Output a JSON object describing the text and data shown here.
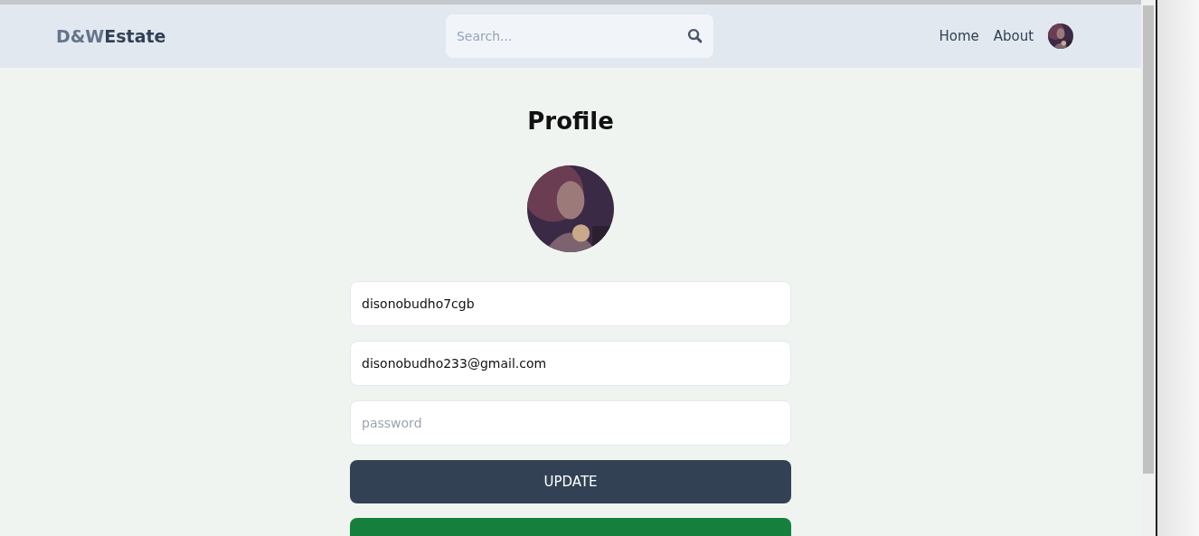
{
  "header": {
    "brand": {
      "first": "D&W",
      "second": "Estate"
    },
    "search": {
      "placeholder": "Search..."
    },
    "nav": [
      {
        "label": "Home"
      },
      {
        "label": "About"
      }
    ]
  },
  "profile": {
    "title": "Profile",
    "fields": [
      {
        "value": "disonobudho7cgb"
      },
      {
        "value": "disonobudho233@gmail.com"
      },
      {
        "placeholder": "password"
      }
    ],
    "buttons": [
      {
        "kind": "update",
        "label": "UPDATE"
      },
      {
        "kind": "create"
      }
    ]
  }
}
